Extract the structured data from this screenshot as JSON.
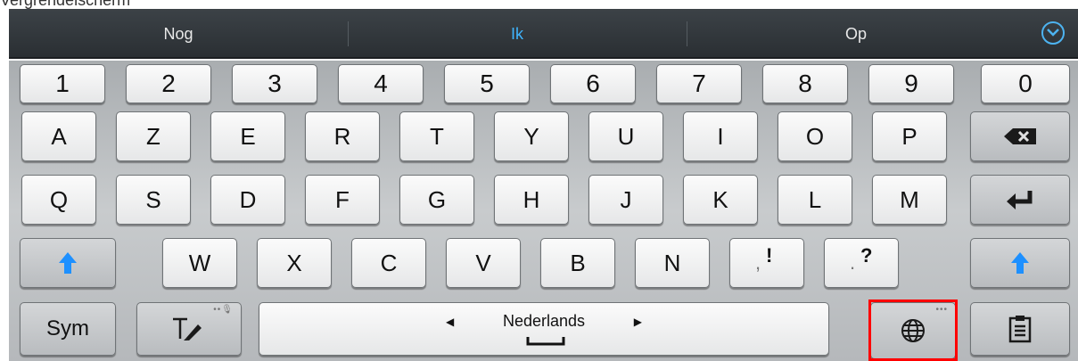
{
  "top_text": "Vergrendelscherm",
  "suggestions": [
    "Nog",
    "Ik",
    "Op"
  ],
  "number_row": [
    "1",
    "2",
    "3",
    "4",
    "5",
    "6",
    "7",
    "8",
    "9",
    "0"
  ],
  "row1": [
    "A",
    "Z",
    "E",
    "R",
    "T",
    "Y",
    "U",
    "I",
    "O",
    "P"
  ],
  "row2": [
    "Q",
    "S",
    "D",
    "F",
    "G",
    "H",
    "J",
    "K",
    "L",
    "M"
  ],
  "row3": [
    "W",
    "X",
    "C",
    "V",
    "B",
    "N"
  ],
  "punct": {
    "comma": ",",
    "excl": "!",
    "period": ".",
    "question": "?"
  },
  "bottom": {
    "sym": "Sym",
    "language": "Nederlands"
  },
  "icons": {
    "expand": "chevron-down-circle-icon",
    "backspace": "backspace-icon",
    "enter": "enter-icon",
    "shift": "shift-arrow-icon",
    "handwriting": "handwriting-pen-icon",
    "globe": "globe-icon",
    "clipboard": "clipboard-icon"
  },
  "colors": {
    "accent": "#3fb5ff",
    "highlight": "#ff0000",
    "shift_arrow": "#1e90ff"
  }
}
